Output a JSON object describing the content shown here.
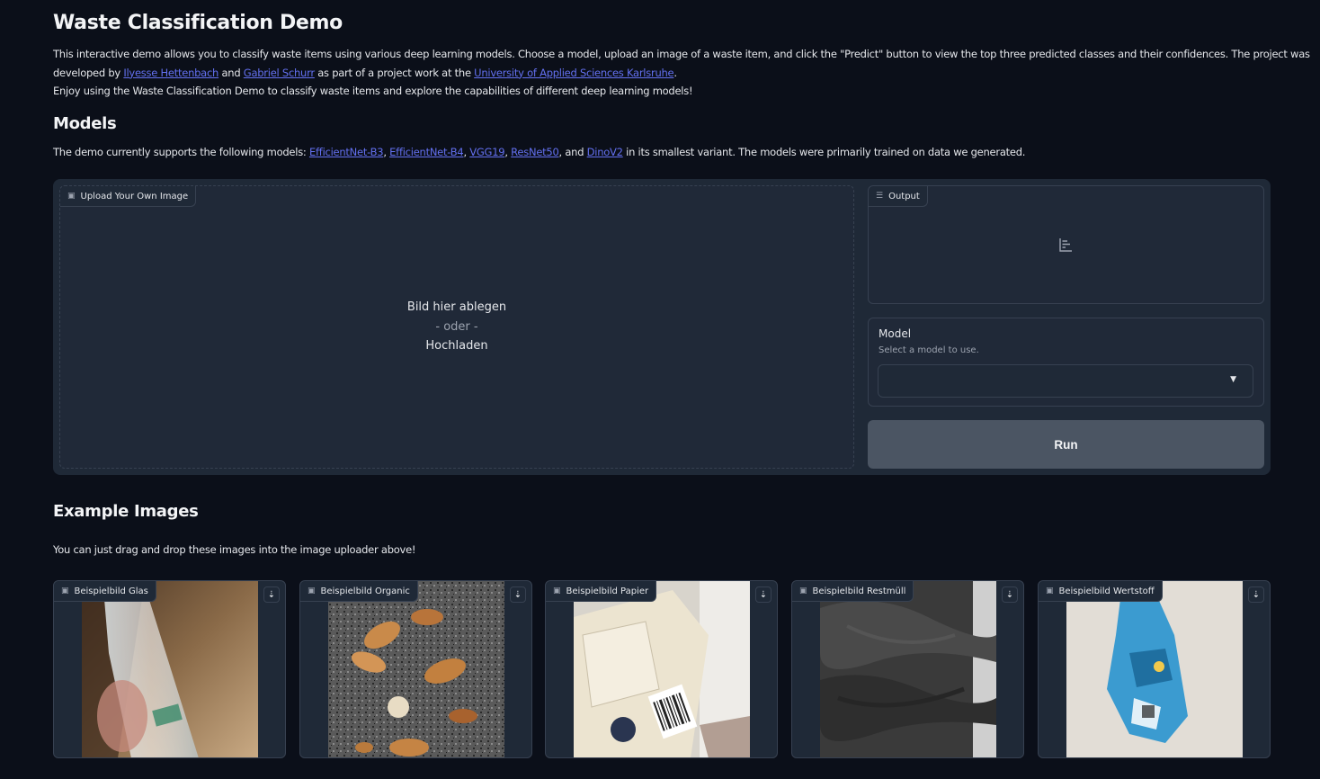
{
  "header": {
    "title": "Waste Classification Demo"
  },
  "intro": {
    "line1": "This interactive demo allows you to classify waste items using various deep learning models. Choose a model, upload an image of a waste item, and click the \"Predict\" button to view the top three predicted classes and their confidences. The project was",
    "developed_by": "developed by ",
    "author1": "Ilyesse Hettenbach",
    "and": " and ",
    "author2": "Gabriel Schurr",
    "as_part": " as part of a project work at the ",
    "university": "University of Applied Sciences Karlsruhe",
    "period": ".",
    "line3": "Enjoy using the Waste Classification Demo to classify waste items and explore the capabilities of different deep learning models!"
  },
  "models": {
    "title": "Models",
    "prefix": "The demo currently supports the following models: ",
    "m1": "EfficientNet-B3",
    "sep1": ", ",
    "m2": "EfficientNet-B4",
    "sep2": ", ",
    "m3": "VGG19",
    "sep3": ", ",
    "m4": "ResNet50",
    "sep4": ", and ",
    "m5": "DinoV2",
    "suffix": " in its smallest variant. The models were primarily trained on data we generated."
  },
  "upload": {
    "label": "Upload Your Own Image",
    "drop": "Bild hier ablegen",
    "or": "- oder -",
    "click": "Hochladen"
  },
  "output": {
    "label": "Output"
  },
  "model_select": {
    "label": "Model",
    "info": "Select a model to use.",
    "value": ""
  },
  "run_button": "Run",
  "examples": {
    "title": "Example Images",
    "text": "You can just drag and drop these images into the image uploader above!",
    "items": [
      {
        "label": "Beispielbild Glas"
      },
      {
        "label": "Beispielbild Organic"
      },
      {
        "label": "Beispielbild Papier"
      },
      {
        "label": "Beispielbild Restmüll"
      },
      {
        "label": "Beispielbild Wertstoff"
      }
    ]
  },
  "colors": {
    "background": "#0b0f19",
    "panel": "#1f2937",
    "link": "#6370f0",
    "button": "#4b5563"
  }
}
